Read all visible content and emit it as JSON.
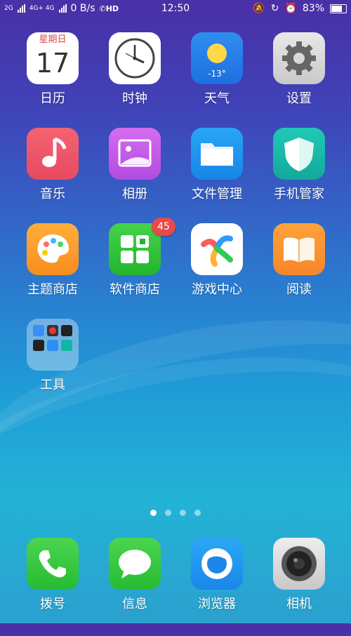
{
  "status_bar": {
    "network_left": "2G",
    "network_right": "4G+ 4G",
    "speed": "0 B/s",
    "hd": "HD",
    "time": "12:50",
    "battery": "83%",
    "battery_level": 0.83
  },
  "apps": [
    {
      "id": "calendar",
      "label": "日历",
      "weekday": "星期日",
      "day": "17"
    },
    {
      "id": "clock",
      "label": "时钟"
    },
    {
      "id": "weather",
      "label": "天气",
      "temp": "-13°"
    },
    {
      "id": "settings",
      "label": "设置"
    },
    {
      "id": "music",
      "label": "音乐"
    },
    {
      "id": "gallery",
      "label": "相册"
    },
    {
      "id": "files",
      "label": "文件管理"
    },
    {
      "id": "security",
      "label": "手机管家"
    },
    {
      "id": "themes",
      "label": "主题商店"
    },
    {
      "id": "appstore",
      "label": "软件商店",
      "badge": "45"
    },
    {
      "id": "gamecenter",
      "label": "游戏中心"
    },
    {
      "id": "reader",
      "label": "阅读"
    },
    {
      "id": "tools",
      "label": "工具"
    }
  ],
  "page_indicator": {
    "pages": 4,
    "active": 0
  },
  "dock": [
    {
      "id": "phone",
      "label": "拨号"
    },
    {
      "id": "messages",
      "label": "信息"
    },
    {
      "id": "browser",
      "label": "浏览器"
    },
    {
      "id": "camera",
      "label": "相机"
    }
  ]
}
